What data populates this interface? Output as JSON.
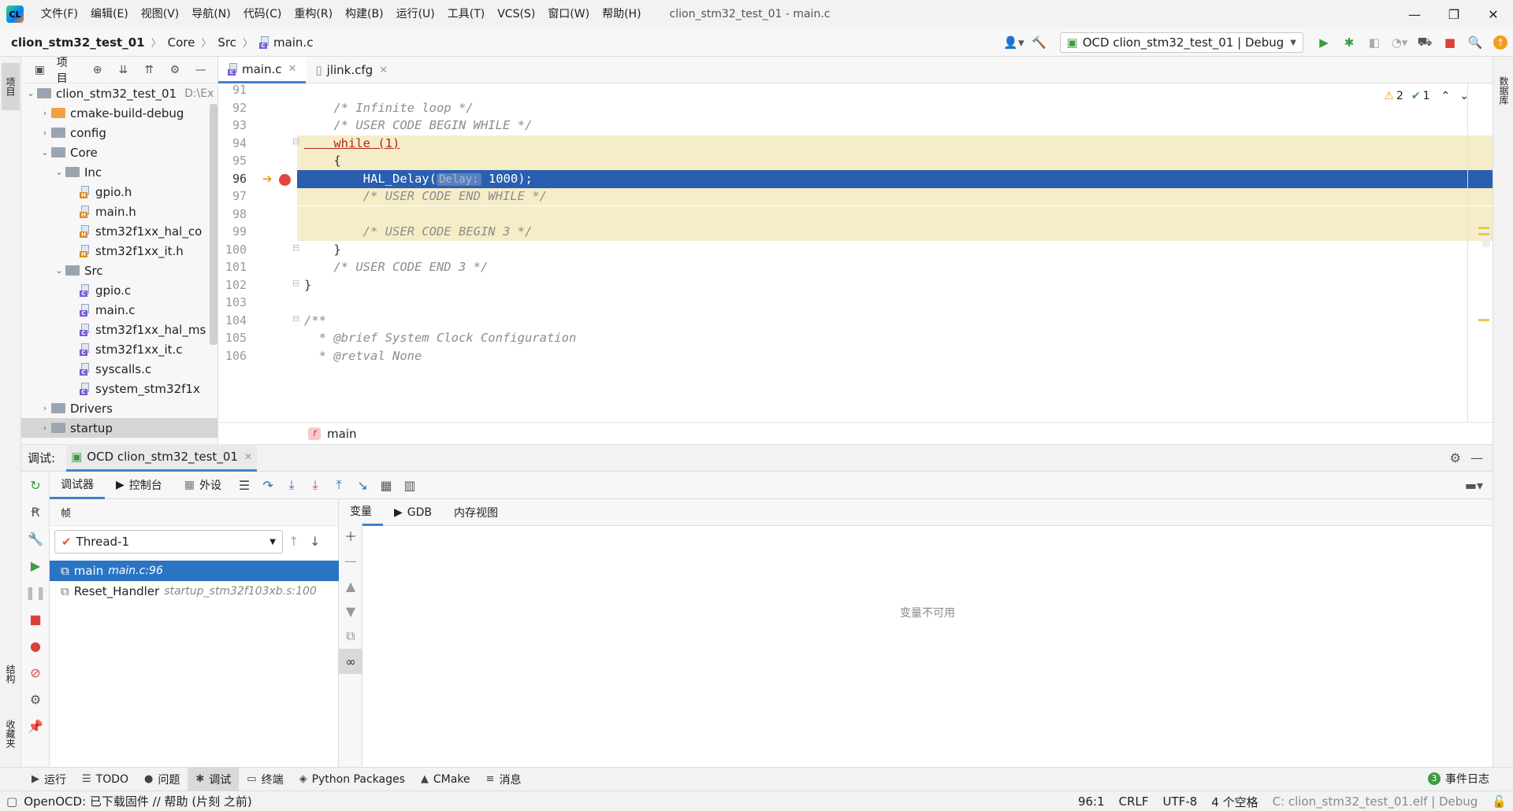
{
  "app": {
    "logo_text": "CL",
    "window_title": "clion_stm32_test_01 - main.c",
    "menu": [
      "文件(F)",
      "编辑(E)",
      "视图(V)",
      "导航(N)",
      "代码(C)",
      "重构(R)",
      "构建(B)",
      "运行(U)",
      "工具(T)",
      "VCS(S)",
      "窗口(W)",
      "帮助(H)"
    ],
    "win_minimize": "—",
    "win_restore": "❐",
    "win_close": "✕"
  },
  "navbar": {
    "project": "clion_stm32_test_01",
    "crumbs": [
      "Core",
      "Src"
    ],
    "file": "main.c",
    "run_config": "OCD clion_stm32_test_01 | Debug"
  },
  "left_strip": {
    "project_tab": "项目",
    "structure_tab": "结构",
    "favorites_tab": "收藏夹"
  },
  "right_strip": {
    "database_tab": "数据库"
  },
  "project_panel": {
    "title": "项目",
    "tree": [
      {
        "label": "clion_stm32_test_01",
        "extra": "D:\\Ex",
        "indent": 0,
        "kind": "root",
        "arrow": "⌄"
      },
      {
        "label": "cmake-build-debug",
        "indent": 1,
        "kind": "folder-orange",
        "arrow": "›"
      },
      {
        "label": "config",
        "indent": 1,
        "kind": "folder",
        "arrow": "›"
      },
      {
        "label": "Core",
        "indent": 1,
        "kind": "folder",
        "arrow": "⌄"
      },
      {
        "label": "Inc",
        "indent": 2,
        "kind": "folder",
        "arrow": "⌄"
      },
      {
        "label": "gpio.h",
        "indent": 3,
        "kind": "h"
      },
      {
        "label": "main.h",
        "indent": 3,
        "kind": "h"
      },
      {
        "label": "stm32f1xx_hal_co",
        "indent": 3,
        "kind": "h"
      },
      {
        "label": "stm32f1xx_it.h",
        "indent": 3,
        "kind": "h"
      },
      {
        "label": "Src",
        "indent": 2,
        "kind": "folder",
        "arrow": "⌄"
      },
      {
        "label": "gpio.c",
        "indent": 3,
        "kind": "c"
      },
      {
        "label": "main.c",
        "indent": 3,
        "kind": "c"
      },
      {
        "label": "stm32f1xx_hal_ms",
        "indent": 3,
        "kind": "c"
      },
      {
        "label": "stm32f1xx_it.c",
        "indent": 3,
        "kind": "c"
      },
      {
        "label": "syscalls.c",
        "indent": 3,
        "kind": "c"
      },
      {
        "label": "system_stm32f1x",
        "indent": 3,
        "kind": "c"
      },
      {
        "label": "Drivers",
        "indent": 1,
        "kind": "folder",
        "arrow": "›"
      },
      {
        "label": "startup",
        "indent": 1,
        "kind": "folder",
        "arrow": "›",
        "selected": true
      }
    ]
  },
  "editor": {
    "tabs": [
      {
        "label": "main.c",
        "active": true
      },
      {
        "label": "jlink.cfg",
        "active": false
      }
    ],
    "inspection": {
      "warnings": "2",
      "ok": "1"
    },
    "lines": [
      {
        "n": "91",
        "text": ""
      },
      {
        "n": "92",
        "text": "    /* Infinite loop */",
        "cls": "cmt"
      },
      {
        "n": "93",
        "text": "    /* USER CODE BEGIN WHILE */",
        "cls": "cmt"
      },
      {
        "n": "94",
        "text": "    while (1)",
        "cls": "kwline",
        "hl": "yellow"
      },
      {
        "n": "95",
        "text": "    {",
        "hl": "yellow"
      },
      {
        "n": "96",
        "text": "        HAL_Delay(",
        "hint": "Delay:",
        "rest": " 1000);",
        "hl": "blue",
        "current": true
      },
      {
        "n": "97",
        "text": "        /* USER CODE END WHILE */",
        "cls": "cmt",
        "hl": "yellow"
      },
      {
        "n": "98",
        "text": "",
        "hl": "yellow"
      },
      {
        "n": "99",
        "text": "        /* USER CODE BEGIN 3 */",
        "cls": "cmt",
        "hl": "yellow"
      },
      {
        "n": "100",
        "text": "    }"
      },
      {
        "n": "101",
        "text": "    /* USER CODE END 3 */",
        "cls": "cmt"
      },
      {
        "n": "102",
        "text": "}"
      },
      {
        "n": "103",
        "text": ""
      },
      {
        "n": "104",
        "text": "/**",
        "cls": "cmt"
      },
      {
        "n": "105",
        "text": "  * @brief System Clock Configuration",
        "cls": "cmt"
      },
      {
        "n": "106",
        "text": "  * @retval None",
        "cls": "cmt"
      }
    ],
    "breadcrumb_fn": "main",
    "fn_badge": "f"
  },
  "debug": {
    "label": "调试:",
    "session": "OCD clion_stm32_test_01",
    "tabs": [
      "调试器",
      "控制台",
      "外设"
    ],
    "frames_title": "帧",
    "thread": "Thread-1",
    "frames": [
      {
        "fn": "main",
        "loc": "main.c:96",
        "selected": true
      },
      {
        "fn": "Reset_Handler",
        "loc": "startup_stm32f103xb.s:100",
        "selected": false
      }
    ],
    "var_tabs": [
      "变量",
      "GDB",
      "内存视图"
    ],
    "no_vars": "变量不可用"
  },
  "toolwindows": [
    {
      "label": "运行",
      "glyph": "▶"
    },
    {
      "label": "TODO",
      "glyph": "☰"
    },
    {
      "label": "问题",
      "glyph": "●"
    },
    {
      "label": "调试",
      "glyph": "✱",
      "active": true
    },
    {
      "label": "终端",
      "glyph": "▭"
    },
    {
      "label": "Python Packages",
      "glyph": "◈"
    },
    {
      "label": "CMake",
      "glyph": "▲"
    },
    {
      "label": "消息",
      "glyph": "≡"
    }
  ],
  "event_log": {
    "count": "3",
    "label": "事件日志"
  },
  "status": {
    "message": "OpenOCD: 已下载固件 // 帮助 (片刻 之前)",
    "position": "96:1",
    "line_sep": "CRLF",
    "encoding": "UTF-8",
    "indent": "4 个空格",
    "context": "C: clion_stm32_test_01.elf | Debug"
  },
  "colors": {
    "selection_blue": "#2a5eb0",
    "exec_yellow": "#f5edc8",
    "accent": "#4083c9"
  }
}
